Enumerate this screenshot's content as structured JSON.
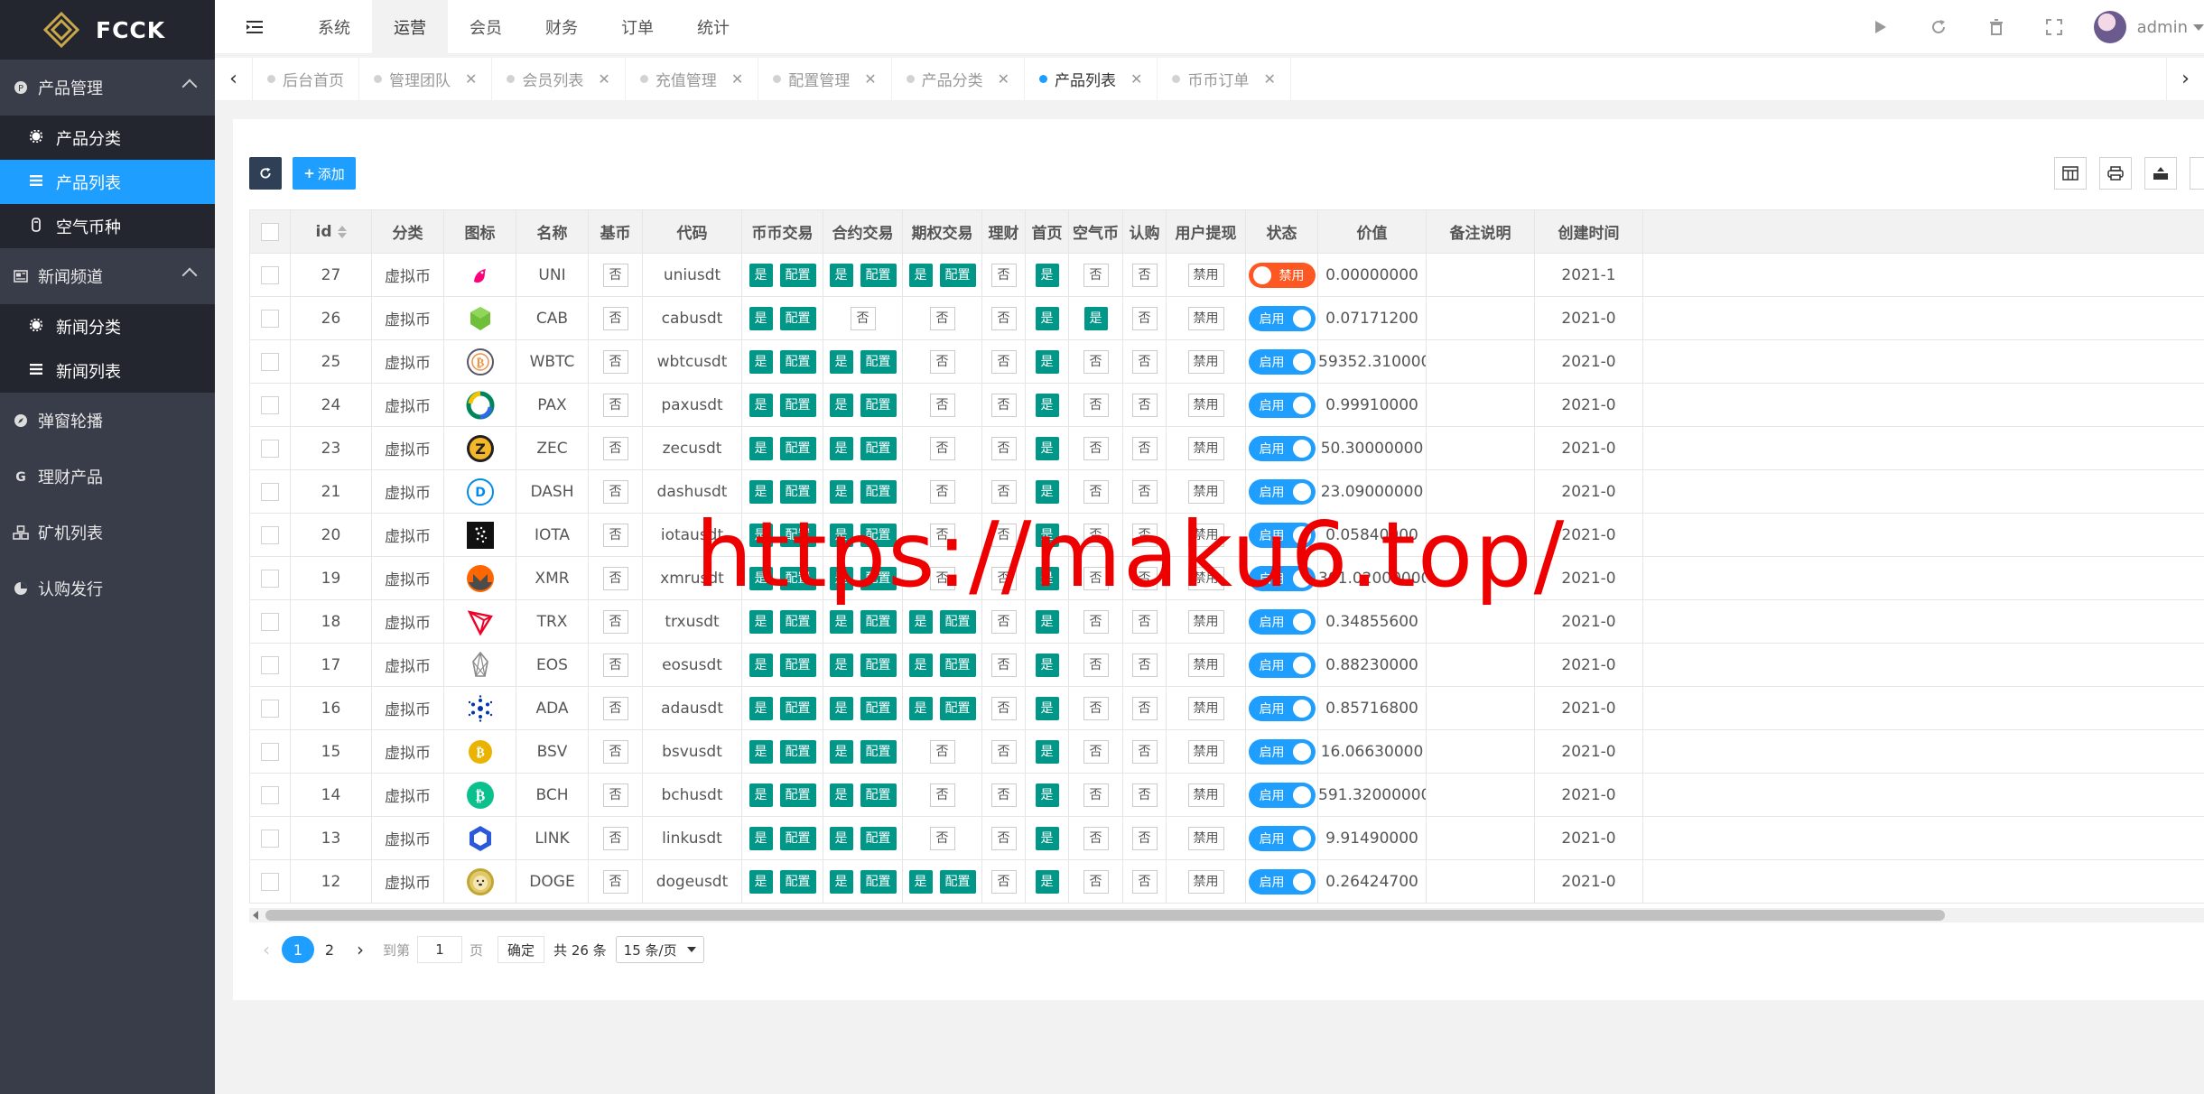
{
  "brand": {
    "name": "FCCK",
    "accent": "#c9a84c"
  },
  "sidebar": {
    "groups": [
      {
        "label": "产品管理",
        "icon": "product-icon",
        "expanded": true,
        "items": [
          {
            "label": "产品分类",
            "icon": "gear-icon",
            "active": false
          },
          {
            "label": "产品列表",
            "icon": "list-icon",
            "active": true
          },
          {
            "label": "空气币种",
            "icon": "hand-icon",
            "active": false
          }
        ]
      },
      {
        "label": "新闻频道",
        "icon": "newspaper-icon",
        "expanded": true,
        "items": [
          {
            "label": "新闻分类",
            "icon": "gear-icon",
            "active": false
          },
          {
            "label": "新闻列表",
            "icon": "list-icon",
            "active": false
          }
        ]
      },
      {
        "label": "弹窗轮播",
        "icon": "compass-icon"
      },
      {
        "label": "理财产品",
        "icon": "g-icon"
      },
      {
        "label": "矿机列表",
        "icon": "cubes-icon"
      },
      {
        "label": "认购发行",
        "icon": "pie-chart-icon"
      }
    ]
  },
  "topbar": {
    "menus": [
      "系统",
      "运营",
      "会员",
      "财务",
      "订单",
      "统计"
    ],
    "active_menu": "运营",
    "user": "admin"
  },
  "tabs": [
    {
      "label": "后台首页",
      "closable": false,
      "active": false
    },
    {
      "label": "管理团队",
      "closable": true,
      "active": false
    },
    {
      "label": "会员列表",
      "closable": true,
      "active": false
    },
    {
      "label": "充值管理",
      "closable": true,
      "active": false
    },
    {
      "label": "配置管理",
      "closable": true,
      "active": false
    },
    {
      "label": "产品分类",
      "closable": true,
      "active": false
    },
    {
      "label": "产品列表",
      "closable": true,
      "active": true
    },
    {
      "label": "币币订单",
      "closable": true,
      "active": false
    }
  ],
  "toolbar": {
    "add_label": "添加"
  },
  "table": {
    "columns": [
      "id",
      "分类",
      "图标",
      "名称",
      "基币",
      "代码",
      "币币交易",
      "合约交易",
      "期权交易",
      "理财",
      "首页",
      "空气币",
      "认购",
      "用户提现",
      "状态",
      "价值",
      "备注说明",
      "创建时间"
    ],
    "labels": {
      "yes": "是",
      "no": "否",
      "config": "配置",
      "disable": "禁用",
      "on": "启用",
      "off": "禁用"
    },
    "rows": [
      {
        "id": "27",
        "cat": "虚拟币",
        "icon": "uni",
        "name": "UNI",
        "base": false,
        "code": "uniusdt",
        "spot": true,
        "contract": true,
        "option": true,
        "finance": false,
        "home": true,
        "air": false,
        "sub": false,
        "status": false,
        "price": "0.00000000",
        "note": "",
        "date": "2021-1"
      },
      {
        "id": "26",
        "cat": "虚拟币",
        "icon": "cab",
        "name": "CAB",
        "base": false,
        "code": "cabusdt",
        "spot": true,
        "contract": false,
        "option": false,
        "finance": false,
        "home": true,
        "air": true,
        "sub": false,
        "status": true,
        "price": "0.07171200",
        "note": "",
        "date": "2021-0"
      },
      {
        "id": "25",
        "cat": "虚拟币",
        "icon": "wbtc",
        "name": "WBTC",
        "base": false,
        "code": "wbtcusdt",
        "spot": true,
        "contract": true,
        "option": false,
        "finance": false,
        "home": true,
        "air": false,
        "sub": false,
        "status": true,
        "price": "59352.31000000",
        "note": "",
        "date": "2021-0"
      },
      {
        "id": "24",
        "cat": "虚拟币",
        "icon": "pax",
        "name": "PAX",
        "base": false,
        "code": "paxusdt",
        "spot": true,
        "contract": true,
        "option": false,
        "finance": false,
        "home": true,
        "air": false,
        "sub": false,
        "status": true,
        "price": "0.99910000",
        "note": "",
        "date": "2021-0"
      },
      {
        "id": "23",
        "cat": "虚拟币",
        "icon": "zec",
        "name": "ZEC",
        "base": false,
        "code": "zecusdt",
        "spot": true,
        "contract": true,
        "option": false,
        "finance": false,
        "home": true,
        "air": false,
        "sub": false,
        "status": true,
        "price": "50.30000000",
        "note": "",
        "date": "2021-0"
      },
      {
        "id": "21",
        "cat": "虚拟币",
        "icon": "dash",
        "name": "DASH",
        "base": false,
        "code": "dashusdt",
        "spot": true,
        "contract": true,
        "option": false,
        "finance": false,
        "home": true,
        "air": false,
        "sub": false,
        "status": true,
        "price": "23.09000000",
        "note": "",
        "date": "2021-0"
      },
      {
        "id": "20",
        "cat": "虚拟币",
        "icon": "iota",
        "name": "IOTA",
        "base": false,
        "code": "iotausdt",
        "spot": true,
        "contract": true,
        "option": false,
        "finance": false,
        "home": true,
        "air": false,
        "sub": false,
        "status": true,
        "price": "0.05840000",
        "note": "",
        "date": "2021-0"
      },
      {
        "id": "19",
        "cat": "虚拟币",
        "icon": "xmr",
        "name": "XMR",
        "base": false,
        "code": "xmrusdt",
        "spot": true,
        "contract": true,
        "option": false,
        "finance": false,
        "home": true,
        "air": false,
        "sub": false,
        "status": true,
        "price": "301.02000000",
        "note": "",
        "date": "2021-0"
      },
      {
        "id": "18",
        "cat": "虚拟币",
        "icon": "trx",
        "name": "TRX",
        "base": false,
        "code": "trxusdt",
        "spot": true,
        "contract": true,
        "option": true,
        "finance": false,
        "home": true,
        "air": false,
        "sub": false,
        "status": true,
        "price": "0.34855600",
        "note": "",
        "date": "2021-0"
      },
      {
        "id": "17",
        "cat": "虚拟币",
        "icon": "eos",
        "name": "EOS",
        "base": false,
        "code": "eosusdt",
        "spot": true,
        "contract": true,
        "option": true,
        "finance": false,
        "home": true,
        "air": false,
        "sub": false,
        "status": true,
        "price": "0.88230000",
        "note": "",
        "date": "2021-0"
      },
      {
        "id": "16",
        "cat": "虚拟币",
        "icon": "ada",
        "name": "ADA",
        "base": false,
        "code": "adausdt",
        "spot": true,
        "contract": true,
        "option": true,
        "finance": false,
        "home": true,
        "air": false,
        "sub": false,
        "status": true,
        "price": "0.85716800",
        "note": "",
        "date": "2021-0"
      },
      {
        "id": "15",
        "cat": "虚拟币",
        "icon": "bsv",
        "name": "BSV",
        "base": false,
        "code": "bsvusdt",
        "spot": true,
        "contract": true,
        "option": false,
        "finance": false,
        "home": true,
        "air": false,
        "sub": false,
        "status": true,
        "price": "16.06630000",
        "note": "",
        "date": "2021-0"
      },
      {
        "id": "14",
        "cat": "虚拟币",
        "icon": "bch",
        "name": "BCH",
        "base": false,
        "code": "bchusdt",
        "spot": true,
        "contract": true,
        "option": false,
        "finance": false,
        "home": true,
        "air": false,
        "sub": false,
        "status": true,
        "price": "591.32000000",
        "note": "",
        "date": "2021-0"
      },
      {
        "id": "13",
        "cat": "虚拟币",
        "icon": "link",
        "name": "LINK",
        "base": false,
        "code": "linkusdt",
        "spot": true,
        "contract": true,
        "option": false,
        "finance": false,
        "home": true,
        "air": false,
        "sub": false,
        "status": true,
        "price": "9.91490000",
        "note": "",
        "date": "2021-0"
      },
      {
        "id": "12",
        "cat": "虚拟币",
        "icon": "doge",
        "name": "DOGE",
        "base": false,
        "code": "dogeusdt",
        "spot": true,
        "contract": true,
        "option": true,
        "finance": false,
        "home": true,
        "air": false,
        "sub": false,
        "status": true,
        "price": "0.26424700",
        "note": "",
        "date": "2021-0"
      }
    ]
  },
  "pager": {
    "pages": [
      "1",
      "2"
    ],
    "current": "1",
    "goto_label": "到第",
    "goto_value": "1",
    "page_label": "页",
    "confirm_label": "确定",
    "total_label": "共 26 条",
    "page_size": "15 条/页"
  },
  "watermark": "https://maku6.top/"
}
